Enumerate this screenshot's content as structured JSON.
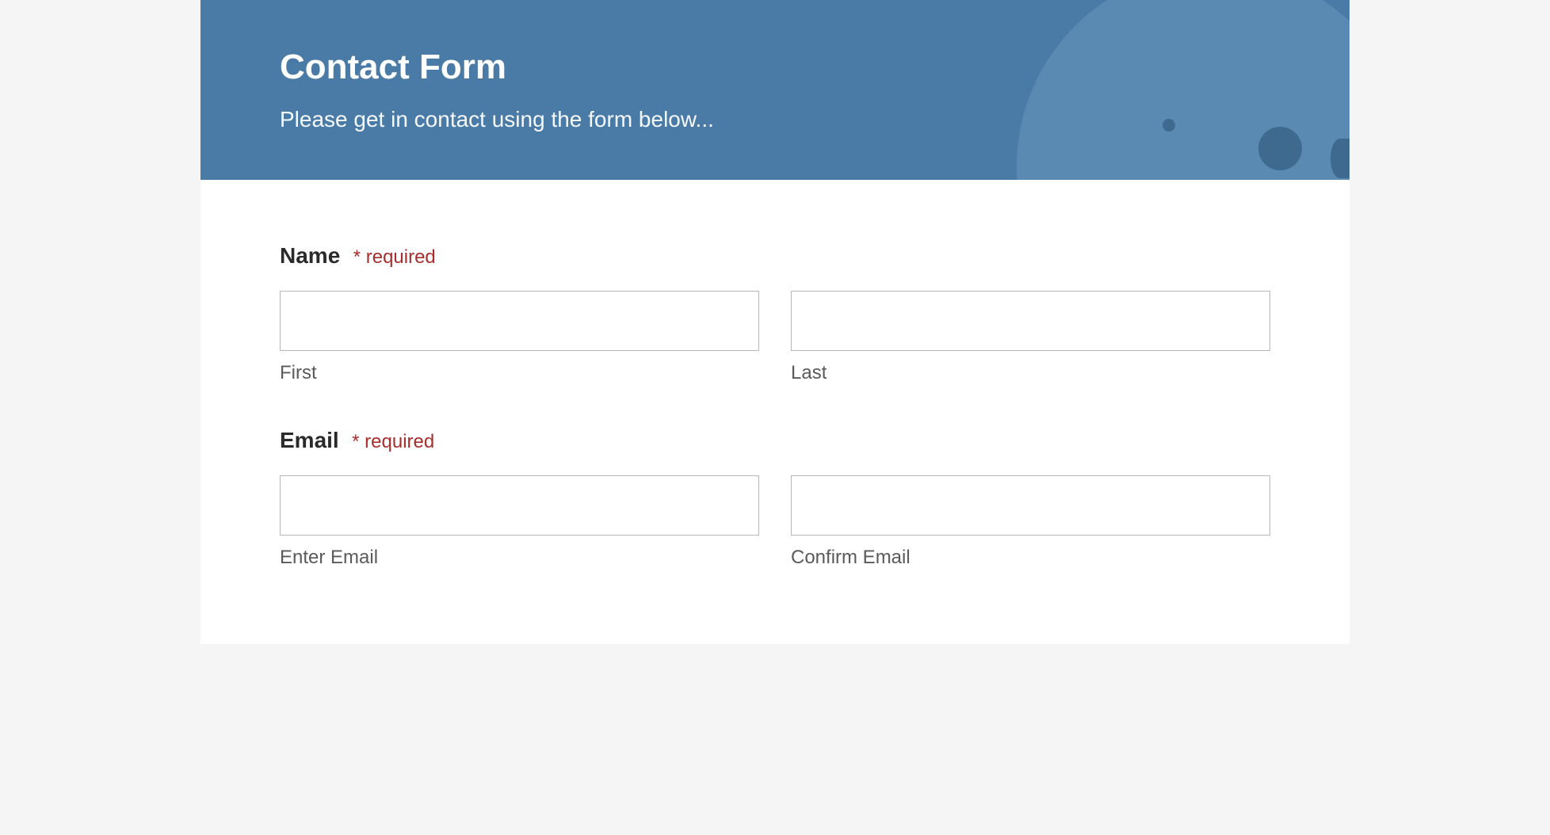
{
  "header": {
    "title": "Contact Form",
    "subtitle": "Please get in contact using the form below..."
  },
  "form": {
    "name": {
      "label": "Name",
      "required_text": "* required",
      "first_sublabel": "First",
      "last_sublabel": "Last",
      "first_value": "",
      "last_value": ""
    },
    "email": {
      "label": "Email",
      "required_text": "* required",
      "enter_sublabel": "Enter Email",
      "confirm_sublabel": "Confirm Email",
      "enter_value": "",
      "confirm_value": ""
    }
  }
}
